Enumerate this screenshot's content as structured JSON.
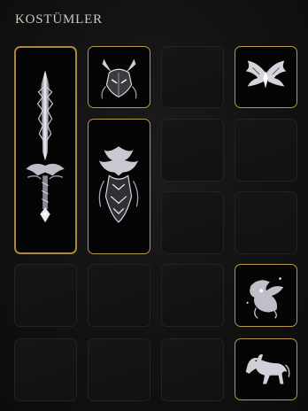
{
  "header": {
    "title": "KOSTÜMLER"
  },
  "inventory": {
    "items": [
      {
        "icon": "sword-icon"
      },
      {
        "icon": "horned-mask-icon"
      },
      {
        "icon": "winged-emblem-icon"
      },
      {
        "icon": "dragon-armor-icon"
      },
      {
        "icon": "dragon-pet-icon"
      },
      {
        "icon": "horse-mount-icon"
      }
    ]
  }
}
